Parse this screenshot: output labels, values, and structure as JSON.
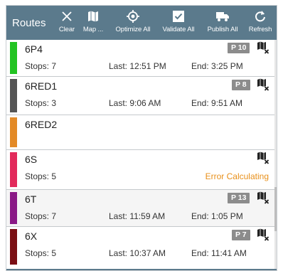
{
  "header": {
    "title": "Routes",
    "tools": [
      {
        "label": "Clear",
        "icon": "close-icon"
      },
      {
        "label": "Map ...",
        "icon": "map-icon"
      },
      {
        "label": "Optimize All",
        "icon": "crosshair-icon"
      },
      {
        "label": "Validate All",
        "icon": "checkbox-icon"
      },
      {
        "label": "Publish All",
        "icon": "truck-icon"
      },
      {
        "label": "Refresh",
        "icon": "refresh-icon"
      }
    ]
  },
  "routes": [
    {
      "name": "6P4",
      "color": "#22c322",
      "badge": "P 10",
      "stops": "Stops: 7",
      "last": "Last: 12:51 PM",
      "end": "End: 3:25 PM"
    },
    {
      "name": "6RED1",
      "color": "#555555",
      "badge": "P 8",
      "stops": "Stops: 3",
      "last": "Last: 9:06 AM",
      "end": "End: 9:51 AM"
    },
    {
      "name": "6RED2",
      "color": "#e38a27"
    },
    {
      "name": "6S",
      "color": "#e22a5b",
      "stops": "Stops: 5",
      "error": "Error Calculating"
    },
    {
      "name": "6T",
      "color": "#8a1a86",
      "badge": "P 13",
      "stops": "Stops: 7",
      "last": "Last: 11:59 AM",
      "end": "End: 1:05 PM"
    },
    {
      "name": "6X",
      "color": "#7a0f14",
      "badge": "P 7",
      "stops": "Stops: 5",
      "last": "Last: 10:37 AM",
      "end": "End: 11:41 AM"
    }
  ]
}
